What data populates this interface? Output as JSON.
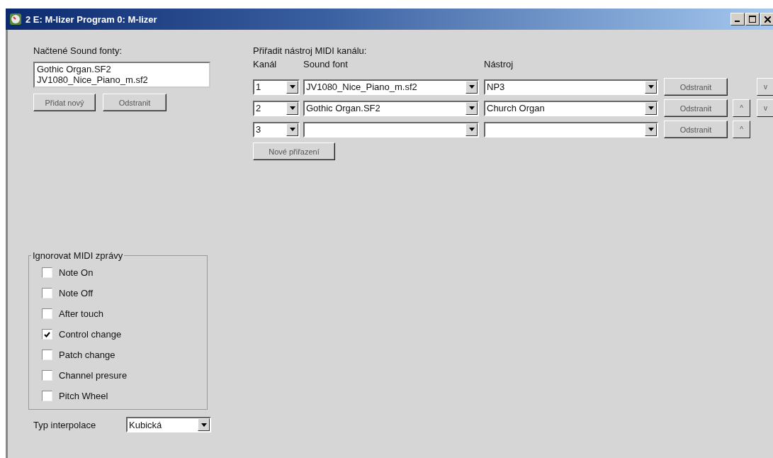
{
  "window": {
    "title": "2 E: M-lizer Program 0: M-lizer"
  },
  "soundfonts": {
    "label": "Načtené Sound fonty:",
    "items": [
      "Gothic Organ.SF2",
      "JV1080_Nice_Piano_m.sf2"
    ],
    "buttons": [
      "Přidat nový",
      "Odstranit"
    ]
  },
  "assign": {
    "title": "Přiřadit nástroj MIDI kanálu:",
    "columns": [
      "Kanál",
      "Sound font",
      "Nástroj"
    ],
    "rows": [
      {
        "channel": "1",
        "soundfont": "JV1080_Nice_Piano_m.sf2",
        "instrument": "NP3",
        "remove": "Odstranit",
        "up": null,
        "down": "v"
      },
      {
        "channel": "2",
        "soundfont": "Gothic Organ.SF2",
        "instrument": "Church Organ",
        "remove": "Odstranit",
        "up": "^",
        "down": "v"
      },
      {
        "channel": "3",
        "soundfont": "",
        "instrument": "",
        "remove": "Odstranit",
        "up": "^",
        "down": null
      }
    ],
    "new_button": "Nové přiřazení"
  },
  "ignore": {
    "title": "Ignorovat MIDI zprávy",
    "items": [
      {
        "label": "Note On",
        "checked": false
      },
      {
        "label": "Note Off",
        "checked": false
      },
      {
        "label": "After touch",
        "checked": false
      },
      {
        "label": "Control change",
        "checked": true
      },
      {
        "label": "Patch change",
        "checked": false
      },
      {
        "label": "Channel presure",
        "checked": false
      },
      {
        "label": "Pitch Wheel",
        "checked": false
      }
    ]
  },
  "interpolation": {
    "label": "Typ interpolace",
    "value": "Kubická"
  }
}
